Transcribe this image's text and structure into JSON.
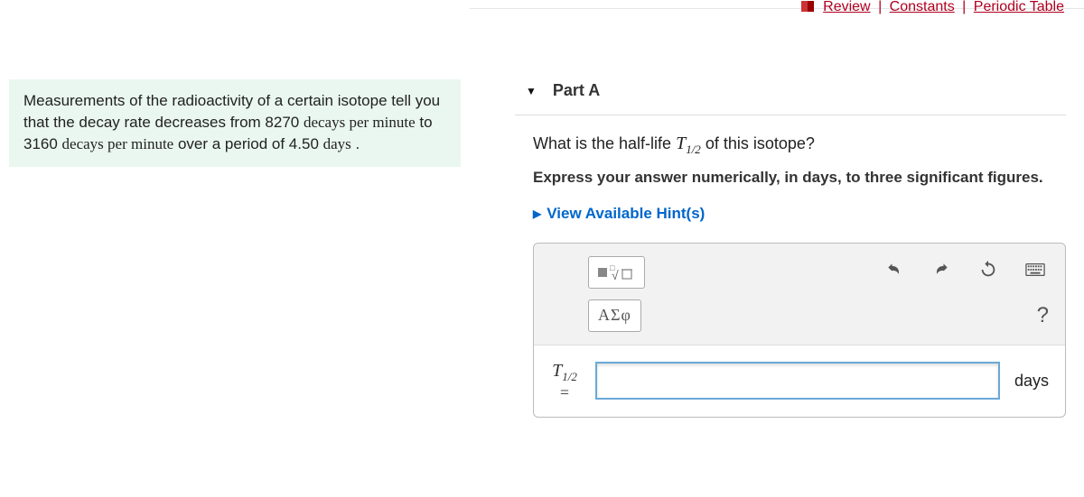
{
  "top_links": {
    "review": "Review",
    "constants": "Constants",
    "periodic_table": "Periodic Table"
  },
  "problem": {
    "text_prefix": "Measurements of the radioactivity of a certain isotope tell you that the decay rate decreases from 8270 ",
    "rate_unit1": "decays per minute",
    "text_mid": " to 3160 ",
    "rate_unit2": "decays per minute",
    "text_mid2": " over a period of 4.50 ",
    "days_unit": "days",
    "text_suffix": " ."
  },
  "part": {
    "label": "Part A"
  },
  "question": {
    "prompt_prefix": "What is the half-life ",
    "var_T": "T",
    "var_sub": "1/2",
    "prompt_suffix": " of this isotope?",
    "instruction": "Express your answer numerically, in days, to three significant figures.",
    "hints_label": "View Available Hint(s)"
  },
  "toolbar": {
    "greek_label": "ΑΣφ",
    "help_label": "?"
  },
  "input": {
    "var_T": "T",
    "var_sub": "1/2",
    "equals": "=",
    "value": "",
    "unit": "days"
  }
}
